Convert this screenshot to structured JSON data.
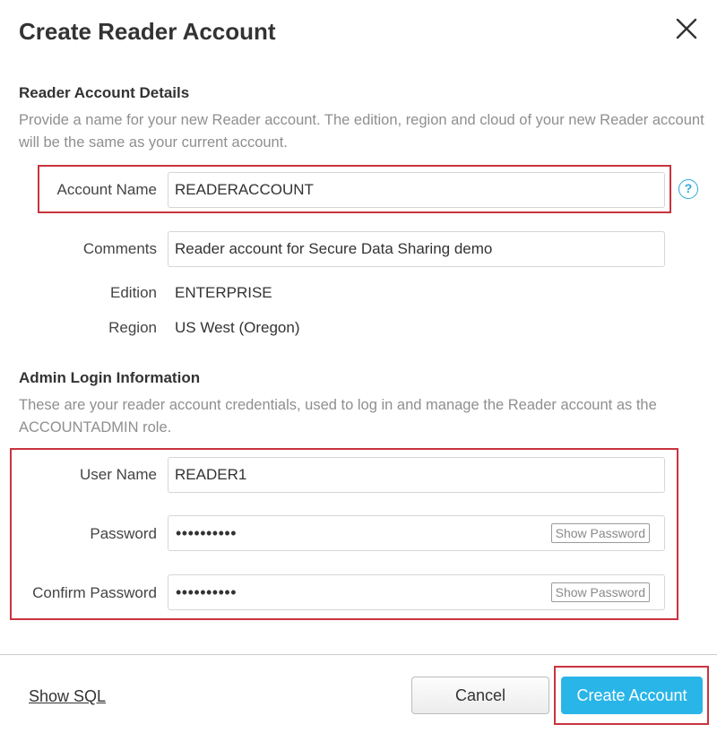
{
  "dialog": {
    "title": "Create Reader Account",
    "close_icon": "close-icon"
  },
  "reader_details": {
    "heading": "Reader Account Details",
    "description": "Provide a name for your new Reader account. The edition, region and cloud of your new Reader account will be the same as your current account.",
    "account_name_label": "Account Name",
    "account_name_value": "READERACCOUNT",
    "help_icon": "question-icon",
    "help_glyph": "?",
    "comments_label": "Comments",
    "comments_value": "Reader account for Secure Data Sharing demo",
    "edition_label": "Edition",
    "edition_value": "ENTERPRISE",
    "region_label": "Region",
    "region_value": "US West (Oregon)"
  },
  "admin_login": {
    "heading": "Admin Login Information",
    "description": "These are your reader account credentials, used to log in and manage the Reader account as the ACCOUNTADMIN role.",
    "user_name_label": "User Name",
    "user_name_value": "READER1",
    "password_label": "Password",
    "password_masked": "••••••••••",
    "confirm_password_label": "Confirm Password",
    "confirm_password_masked": "••••••••••",
    "show_password_label": "Show Password"
  },
  "footer": {
    "show_sql_label": "Show SQL",
    "cancel_label": "Cancel",
    "create_label": "Create Account"
  },
  "colors": {
    "accent": "#29b5e8",
    "highlight_box": "#c9343e",
    "muted_text": "#8f8f8f"
  }
}
